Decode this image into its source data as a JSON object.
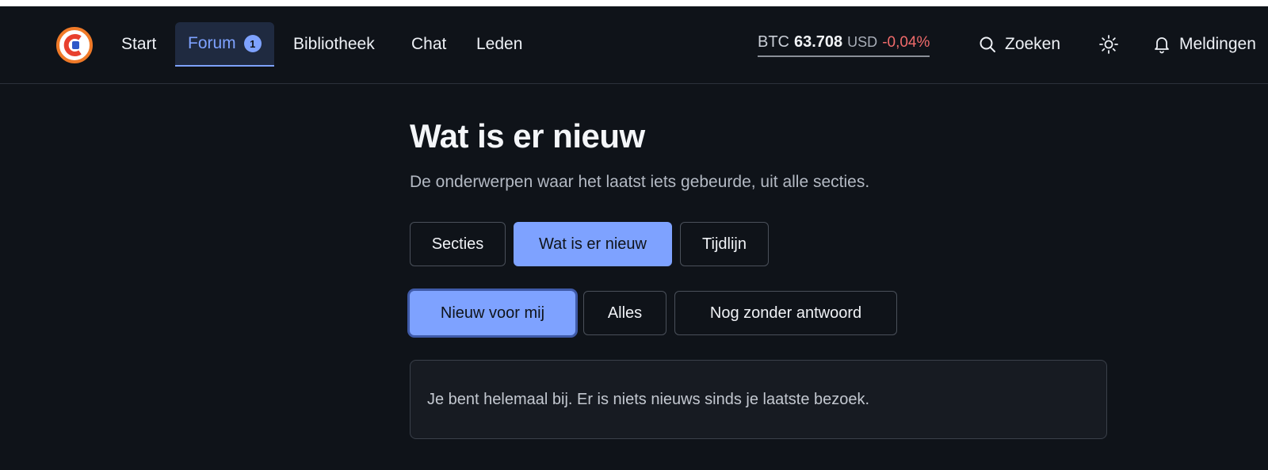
{
  "navbar": {
    "items": [
      {
        "label": "Start"
      },
      {
        "label": "Forum",
        "badge": "1",
        "active": true
      },
      {
        "label": "Bibliotheek"
      },
      {
        "label": "Chat"
      },
      {
        "label": "Leden"
      }
    ],
    "ticker": {
      "symbol": "BTC",
      "price": "63.708",
      "currency": "USD",
      "change": "-0,04%"
    },
    "search_label": "Zoeken",
    "notifications_label": "Meldingen"
  },
  "main": {
    "title": "Wat is er nieuw",
    "subtitle": "De onderwerpen waar het laatst iets gebeurde, uit alle secties.",
    "tabs": [
      {
        "label": "Secties",
        "selected": false
      },
      {
        "label": "Wat is er nieuw",
        "selected": true
      },
      {
        "label": "Tijdlijn",
        "selected": false
      }
    ],
    "filters": [
      {
        "label": "Nieuw voor mij",
        "selected": true
      },
      {
        "label": "Alles",
        "selected": false
      },
      {
        "label": "Nog zonder antwoord",
        "selected": false
      }
    ],
    "empty_message": "Je bent helemaal bij. Er is niets nieuws sinds je laatste bezoek."
  },
  "colors": {
    "background": "#0f1319",
    "accent": "#7ea2ff",
    "negative": "#f06b6b"
  },
  "icons": {
    "logo": "logo-icon",
    "search": "search-icon",
    "theme": "sun-icon",
    "notifications": "bell-icon"
  }
}
